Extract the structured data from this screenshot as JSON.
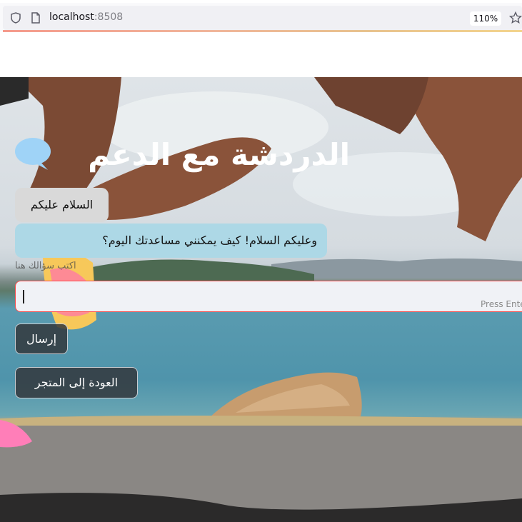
{
  "browser": {
    "url_host": "localhost",
    "url_port": ":8508",
    "zoom": "110%"
  },
  "page": {
    "title": "الدردشة مع الدعم",
    "chat": [
      {
        "role": "user",
        "text": "السلام عليكم"
      },
      {
        "role": "assistant",
        "text": "وعليكم السلام! كيف يمكنني مساعدتك اليوم؟"
      }
    ],
    "input_label": "اكتب سؤالك هنا",
    "input_value": "",
    "input_hint": "Press Enter",
    "send_label": "إرسال",
    "back_label": "العودة إلى المتجر"
  },
  "colors": {
    "user_bubble": "#d9d9d9",
    "assistant_bubble": "#add8e6",
    "input_border": "#ff4b4b",
    "title": "#ffffff"
  }
}
